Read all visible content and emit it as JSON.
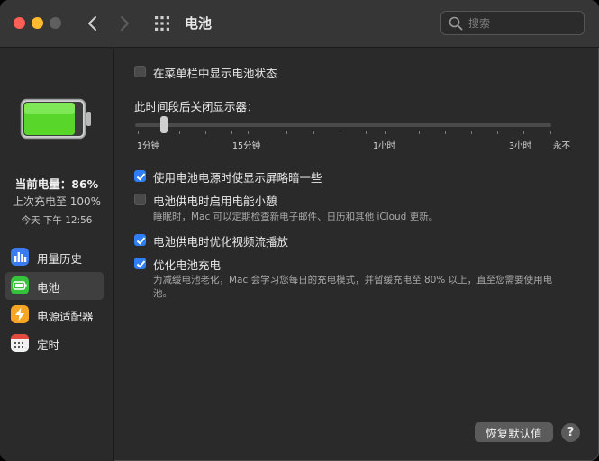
{
  "window": {
    "title": "电池"
  },
  "search": {
    "placeholder": "搜索"
  },
  "sidebar": {
    "level": "当前电量：86%",
    "last_charge": "上次充电至 100%",
    "time": "今天 下午 12:56",
    "items": [
      {
        "label": "用量历史",
        "icon": "usage-history-icon",
        "color": "#3a7bf0"
      },
      {
        "label": "电池",
        "icon": "battery-icon",
        "color": "#36c23a",
        "active": true
      },
      {
        "label": "电源适配器",
        "icon": "power-adapter-icon",
        "color": "#f5a623"
      },
      {
        "label": "定时",
        "icon": "schedule-icon",
        "color": "#f1f1f1"
      }
    ]
  },
  "main": {
    "show_in_menubar": {
      "label": "在菜单栏中显示电池状态",
      "checked": false
    },
    "display_off": {
      "label": "此时间段后关闭显示器：",
      "ticks": [
        "1分钟",
        "15分钟",
        "1小时",
        "3小时",
        "永不"
      ],
      "value": "2分钟"
    },
    "dim_on_battery": {
      "label": "使用电池电源时使显示屏略暗一些",
      "checked": true
    },
    "power_nap": {
      "label": "电池供电时启用电能小憩",
      "checked": false,
      "description": "睡眠时，Mac 可以定期检查新电子邮件、日历和其他 iCloud 更新。"
    },
    "optimize_video": {
      "label": "电池供电时优化视频流播放",
      "checked": true
    },
    "optimized_charging": {
      "label": "优化电池充电",
      "checked": true,
      "description": "为减缓电池老化，Mac 会学习您每日的充电模式，并暂缓充电至 80% 以上，直至您需要使用电池。"
    }
  },
  "footer": {
    "restore_label": "恢复默认值",
    "help_label": "?"
  },
  "colors": {
    "accent": "#2f7ef6",
    "battery_fill": "#58d62a"
  }
}
